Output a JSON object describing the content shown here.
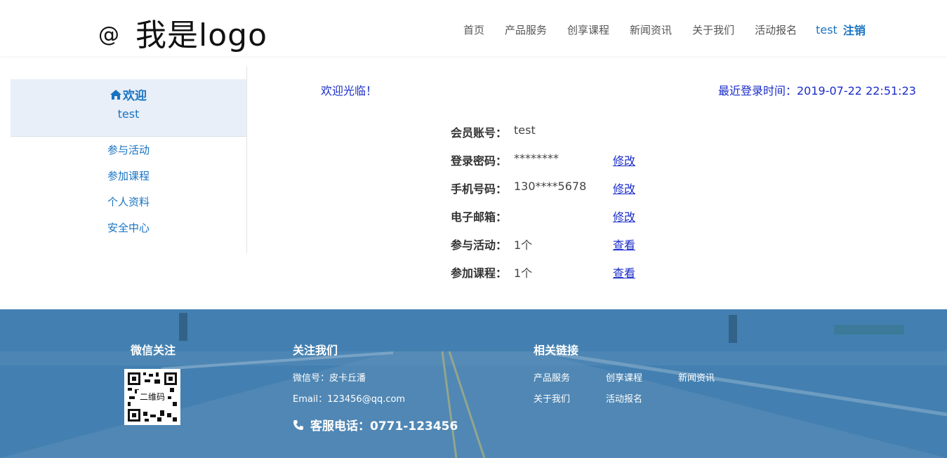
{
  "header": {
    "logo_at": "@",
    "logo_text": "我是logo",
    "nav": [
      "首页",
      "产品服务",
      "创享课程",
      "新闻资讯",
      "关于我们",
      "活动报名"
    ],
    "user": "test",
    "logout": "注销"
  },
  "sidebar": {
    "welcome": "欢迎",
    "user": "test",
    "links": [
      "参与活动",
      "参加课程",
      "个人资料",
      "安全中心"
    ]
  },
  "main": {
    "greeting": "欢迎光临！",
    "last_login": "最近登录时间：2019-07-22 22:51:23",
    "rows": [
      {
        "label": "会员账号：",
        "value": "test",
        "action": ""
      },
      {
        "label": "登录密码：",
        "value": "********",
        "action": "修改"
      },
      {
        "label": "手机号码：",
        "value": "130****5678",
        "action": "修改"
      },
      {
        "label": "电子邮箱：",
        "value": "",
        "action": "修改"
      },
      {
        "label": "参与活动：",
        "value": "1个",
        "action": "查看"
      },
      {
        "label": "参加课程：",
        "value": "1个",
        "action": "查看"
      }
    ]
  },
  "footer": {
    "wechat_title": "微信关注",
    "qr_label": "二维码",
    "follow_title": "关注我们",
    "wechat_id": "微信号：皮卡丘潘",
    "email": "Email：123456@qq.com",
    "phone": "客服电话：0771-123456",
    "links_title": "相关链接",
    "links": [
      "产品服务",
      "创享课程",
      "新闻资讯",
      "关于我们",
      "活动报名"
    ]
  },
  "colors": {
    "accent": "#1a73c2",
    "link": "#1a2cc9",
    "footer_bg": "#4d88b9"
  }
}
